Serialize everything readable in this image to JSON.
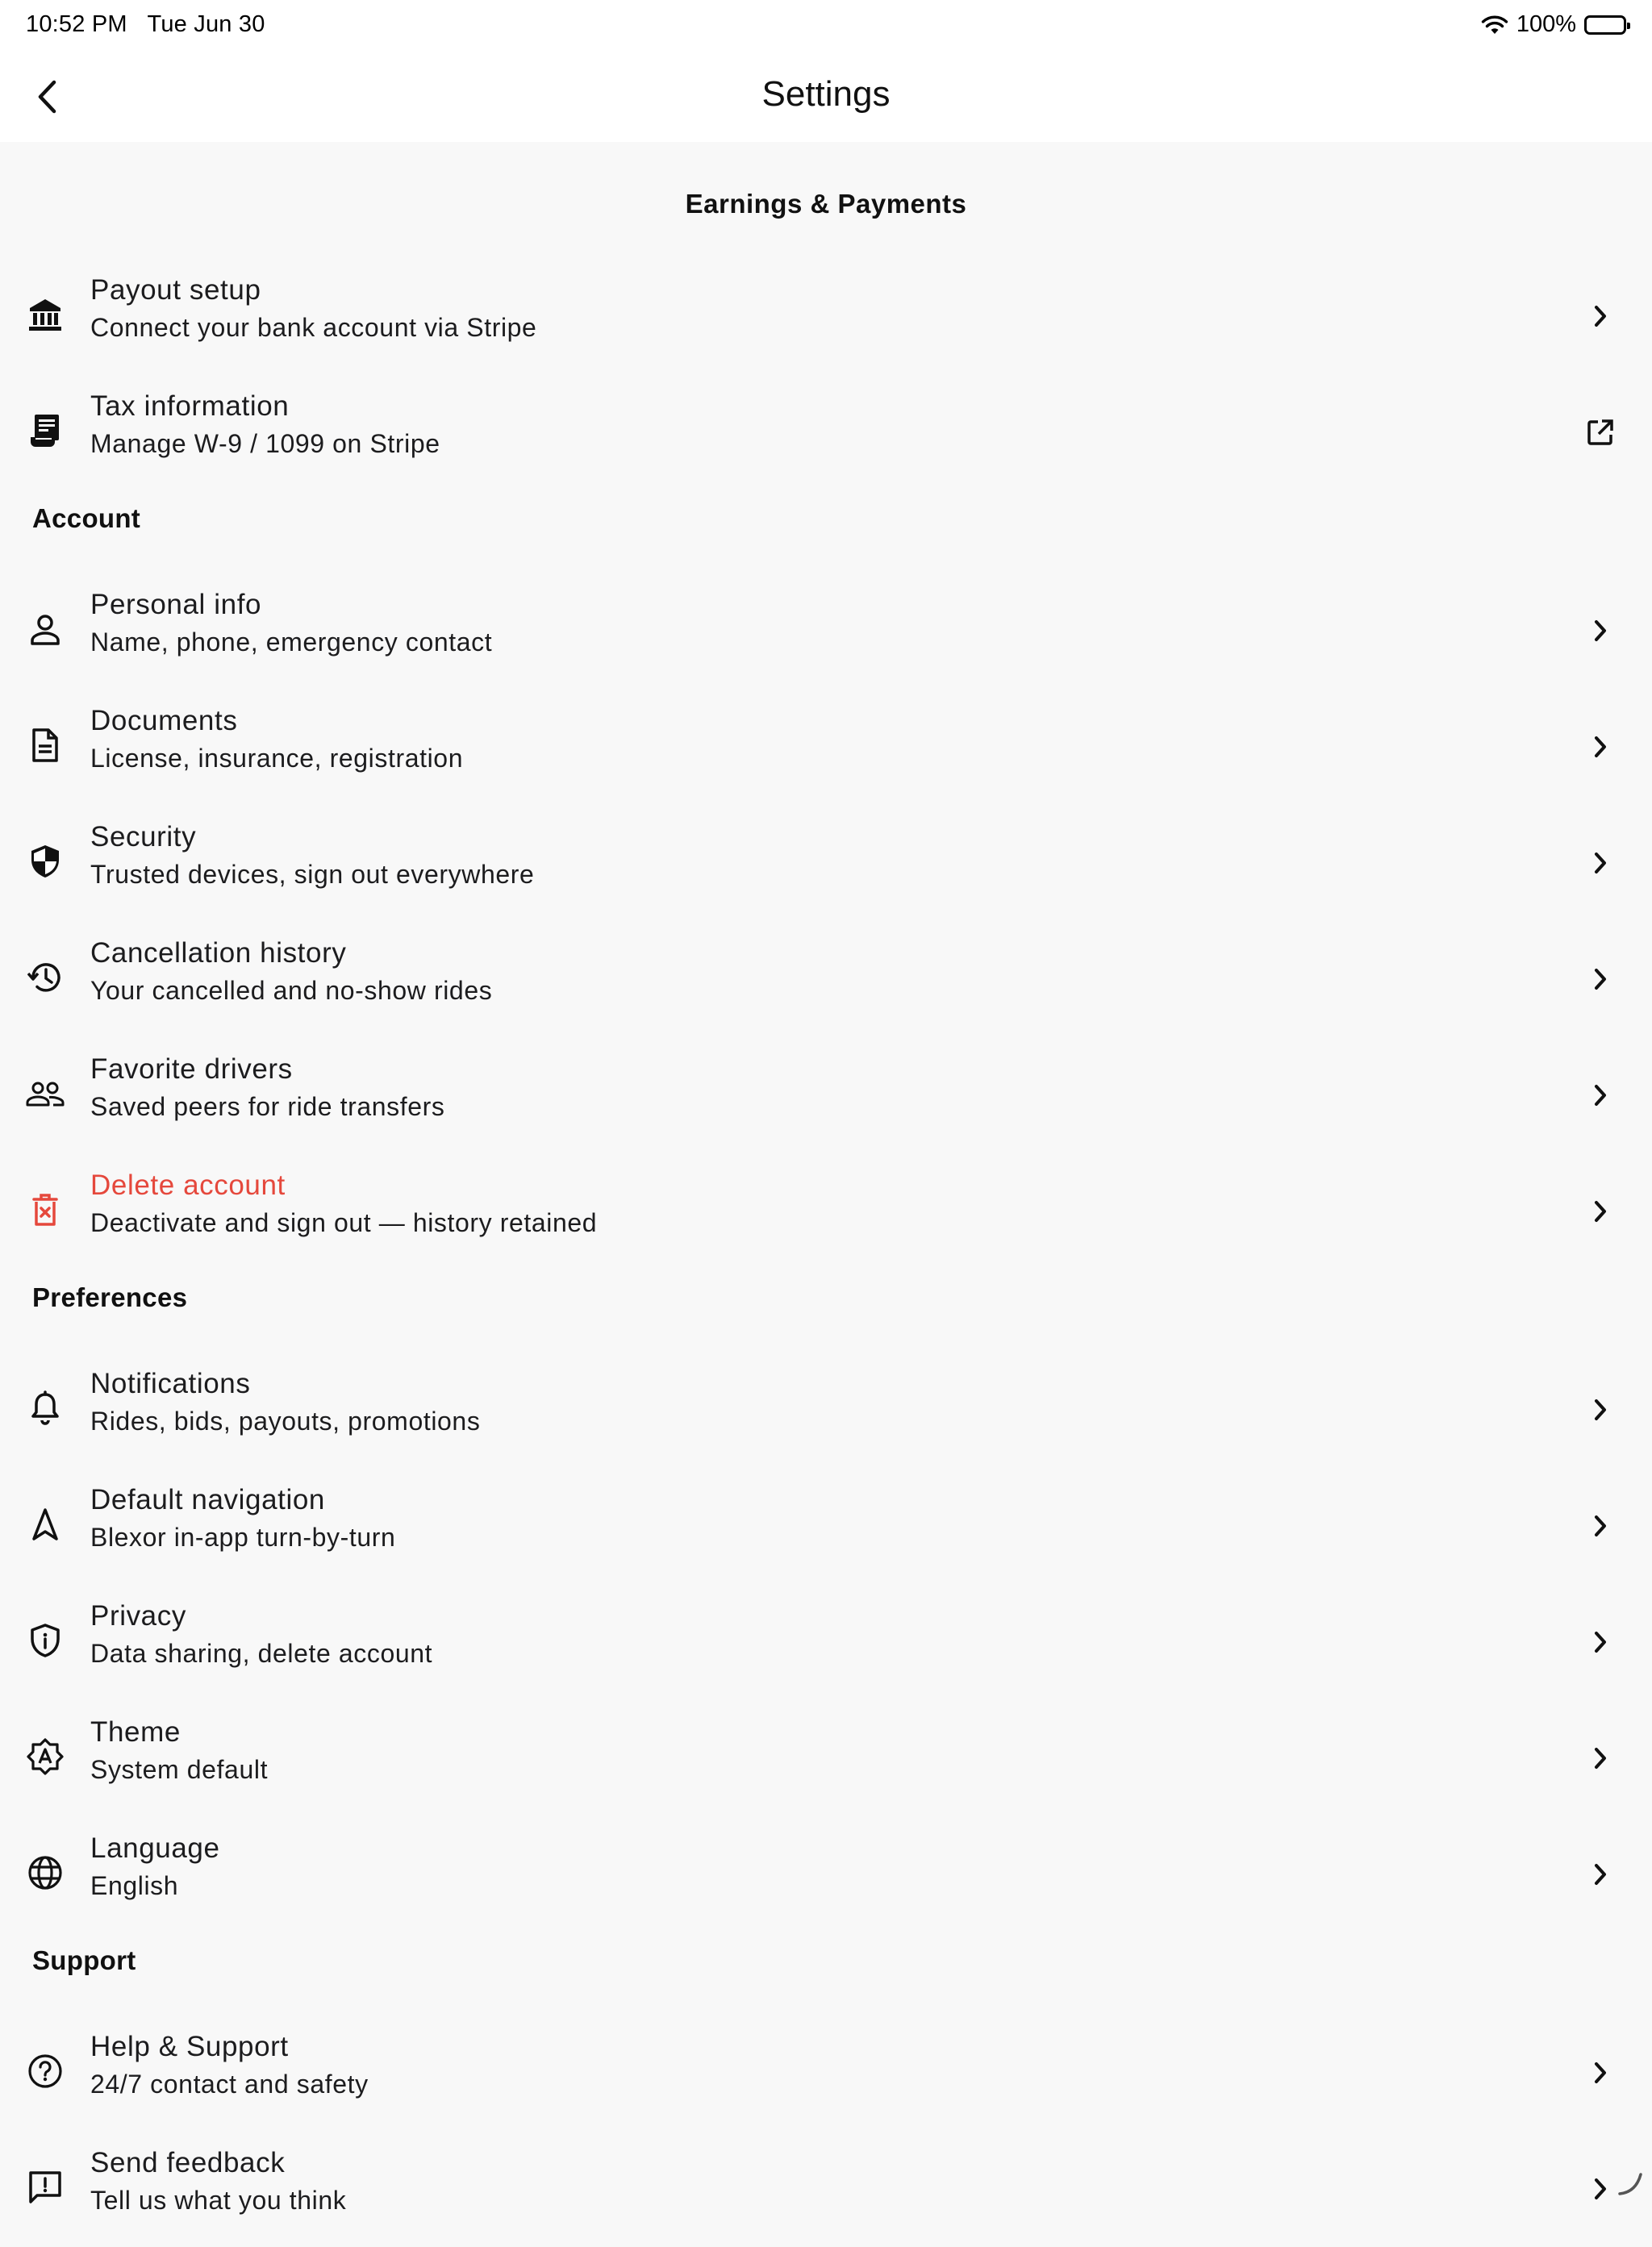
{
  "status_bar": {
    "time": "10:52 PM",
    "date": "Tue Jun 30",
    "battery": "100%"
  },
  "header": {
    "title": "Settings",
    "back_icon": "chevron-left-icon"
  },
  "sections": {
    "earnings": {
      "label": "Earnings & Payments",
      "items": [
        {
          "title": "Payout setup",
          "subtitle": "Connect your bank account via Stripe",
          "icon": "bank-icon",
          "trailing": "chevron-right-icon"
        },
        {
          "title": "Tax information",
          "subtitle": "Manage W-9 / 1099 on Stripe",
          "icon": "receipt-icon",
          "trailing": "open-external-icon"
        }
      ]
    },
    "account": {
      "label": "Account",
      "items": [
        {
          "title": "Personal info",
          "subtitle": "Name, phone, emergency contact",
          "icon": "person-icon",
          "trailing": "chevron-right-icon"
        },
        {
          "title": "Documents",
          "subtitle": "License, insurance, registration",
          "icon": "document-icon",
          "trailing": "chevron-right-icon"
        },
        {
          "title": "Security",
          "subtitle": "Trusted devices, sign out everywhere",
          "icon": "shield-icon",
          "trailing": "chevron-right-icon"
        },
        {
          "title": "Cancellation history",
          "subtitle": "Your cancelled and no-show rides",
          "icon": "history-icon",
          "trailing": "chevron-right-icon"
        },
        {
          "title": "Favorite drivers",
          "subtitle": "Saved peers for ride transfers",
          "icon": "people-icon",
          "trailing": "chevron-right-icon"
        },
        {
          "title": "Delete account",
          "subtitle": "Deactivate and sign out — history retained",
          "icon": "trash-icon",
          "trailing": "chevron-right-icon"
        }
      ]
    },
    "preferences": {
      "label": "Preferences",
      "items": [
        {
          "title": "Notifications",
          "subtitle": "Rides, bids, payouts, promotions",
          "icon": "bell-icon",
          "trailing": "chevron-right-icon"
        },
        {
          "title": "Default navigation",
          "subtitle": "Blexor in-app turn-by-turn",
          "icon": "navigation-arrow-icon",
          "trailing": "chevron-right-icon"
        },
        {
          "title": "Privacy",
          "subtitle": "Data sharing, delete account",
          "icon": "privacy-shield-icon",
          "trailing": "chevron-right-icon"
        },
        {
          "title": "Theme",
          "subtitle": "System default",
          "icon": "theme-auto-icon",
          "trailing": "chevron-right-icon"
        },
        {
          "title": "Language",
          "subtitle": "English",
          "icon": "globe-icon",
          "trailing": "chevron-right-icon"
        }
      ]
    },
    "support": {
      "label": "Support",
      "items": [
        {
          "title": "Help & Support",
          "subtitle": "24/7 contact and safety",
          "icon": "help-circle-icon",
          "trailing": "chevron-right-icon"
        },
        {
          "title": "Send feedback",
          "subtitle": "Tell us what you think",
          "icon": "feedback-icon",
          "trailing": "chevron-right-icon"
        }
      ]
    }
  },
  "colors": {
    "background": "#f8f8f8",
    "header_background": "#ffffff",
    "text": "#1c1c1e",
    "danger": "#e5483c"
  }
}
